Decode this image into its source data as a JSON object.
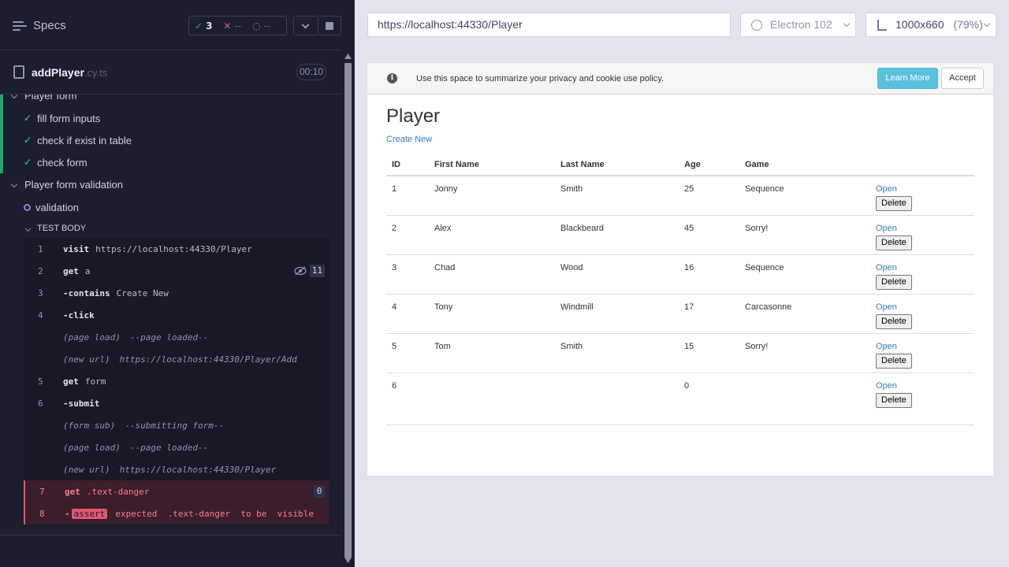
{
  "runner": {
    "specs_label": "Specs",
    "stats": {
      "passed": "3",
      "failed": "--",
      "pending": "--"
    },
    "file": {
      "name": "addPlayer",
      "ext": ".cy.ts",
      "duration": "00:10"
    },
    "suites": [
      {
        "title": "Player form",
        "tests": [
          "fill form inputs",
          "check if exist in table",
          "check form"
        ]
      },
      {
        "title": "Player form validation",
        "tests": [
          "validation"
        ]
      }
    ],
    "test_body_label": "TEST BODY",
    "commands": [
      {
        "n": "1",
        "name": "visit",
        "msg": "https://localhost:44330/Player"
      },
      {
        "n": "2",
        "name": "get",
        "msg": "a",
        "badge": "11"
      },
      {
        "n": "3",
        "name": "-contains",
        "msg": "Create New"
      },
      {
        "n": "4",
        "name": "-click",
        "msg": ""
      },
      {
        "n": "",
        "event": "(page load)",
        "msg": "--page loaded--"
      },
      {
        "n": "",
        "event": "(new url)",
        "msg": "https://localhost:44330/Player/Add"
      },
      {
        "n": "5",
        "name": "get",
        "msg": "form"
      },
      {
        "n": "6",
        "name": "-submit",
        "msg": ""
      },
      {
        "n": "",
        "event": "(form sub)",
        "msg": "--submitting form--"
      },
      {
        "n": "",
        "event": "(page load)",
        "msg": "--page loaded--"
      },
      {
        "n": "",
        "event": "(new url)",
        "msg": "https://localhost:44330/Player"
      },
      {
        "n": "7",
        "name": "get",
        "msg": ".text-danger",
        "badge": "0",
        "error": true
      },
      {
        "n": "8",
        "name": "-",
        "assert": "assert",
        "msg": "expected  .text-danger  to be  visible",
        "error": true
      }
    ]
  },
  "preview": {
    "url": "https://localhost:44330/Player",
    "browser": "Electron 102",
    "viewport": "1000x660",
    "zoom": "(79%)"
  },
  "app": {
    "cookie_text": "Use this space to summarize your privacy and cookie use policy.",
    "learn_more": "Learn More",
    "accept": "Accept",
    "title": "Player",
    "create_new": "Create New",
    "columns": [
      "ID",
      "First Name",
      "Last Name",
      "Age",
      "Game"
    ],
    "open_label": "Open",
    "delete_label": "Delete",
    "rows": [
      [
        "1",
        "Jonny",
        "Smith",
        "25",
        "Sequence"
      ],
      [
        "2",
        "Alex",
        "Blackbeard",
        "45",
        "Sorry!"
      ],
      [
        "3",
        "Chad",
        "Wood",
        "16",
        "Sequence"
      ],
      [
        "4",
        "Tony",
        "Windmill",
        "17",
        "Carcasonne"
      ],
      [
        "5",
        "Tom",
        "Smith",
        "15",
        "Sorry!"
      ],
      [
        "6",
        "",
        "",
        "0",
        ""
      ]
    ]
  },
  "colors": {
    "pass": "#1fa971",
    "fail": "#e45770",
    "link": "#337ab7",
    "info_btn": "#5bc0de"
  }
}
